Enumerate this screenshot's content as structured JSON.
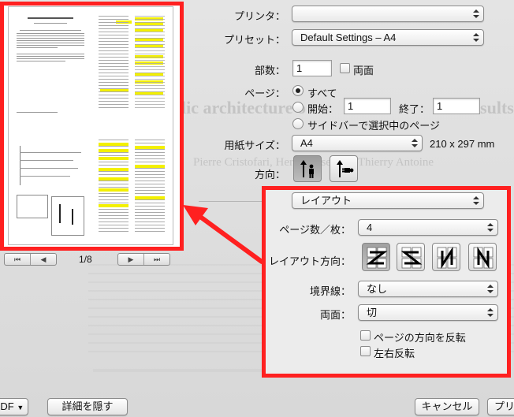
{
  "background": {
    "title_fragment_left": "lic architecture o",
    "title_fragment_right": "sults",
    "authors_fragment": "Pierre Cristofari, Hervé Ansellem, Thierry Antoine"
  },
  "preview": {
    "page_counter": "1/8"
  },
  "form": {
    "printer_label": "プリンタ：",
    "printer_value": "",
    "preset_label": "プリセット：",
    "preset_value": "Default Settings – A4",
    "copies_label": "部数：",
    "copies_value": "1",
    "duplex_label": "両面",
    "pages_label": "ページ：",
    "pages_all": "すべて",
    "pages_from_label": "開始：",
    "pages_from_value": "1",
    "pages_to_label": "終了：",
    "pages_to_value": "1",
    "pages_sidebar": "サイドバーで選択中のページ",
    "paper_label": "用紙サイズ：",
    "paper_value": "A4",
    "paper_dims": "210 x 297 mm",
    "orientation_label": "方向："
  },
  "layout_panel": {
    "section_value": "レイアウト",
    "pages_per_sheet_label": "ページ数／枚：",
    "pages_per_sheet_value": "4",
    "direction_label": "レイアウト方向：",
    "border_label": "境界線：",
    "border_value": "なし",
    "two_sided_label": "両面：",
    "two_sided_value": "切",
    "reverse_orientation_label": "ページの方向を反転",
    "flip_horizontal_label": "左右反転"
  },
  "bottom": {
    "pdf_label": "PDF",
    "hide_details_label": "詳細を隠す",
    "cancel_label": "キャンセル",
    "print_label": "プリ"
  },
  "colors": {
    "annotation_red": "#ff2020",
    "highlight_yellow": "#f3f000"
  }
}
